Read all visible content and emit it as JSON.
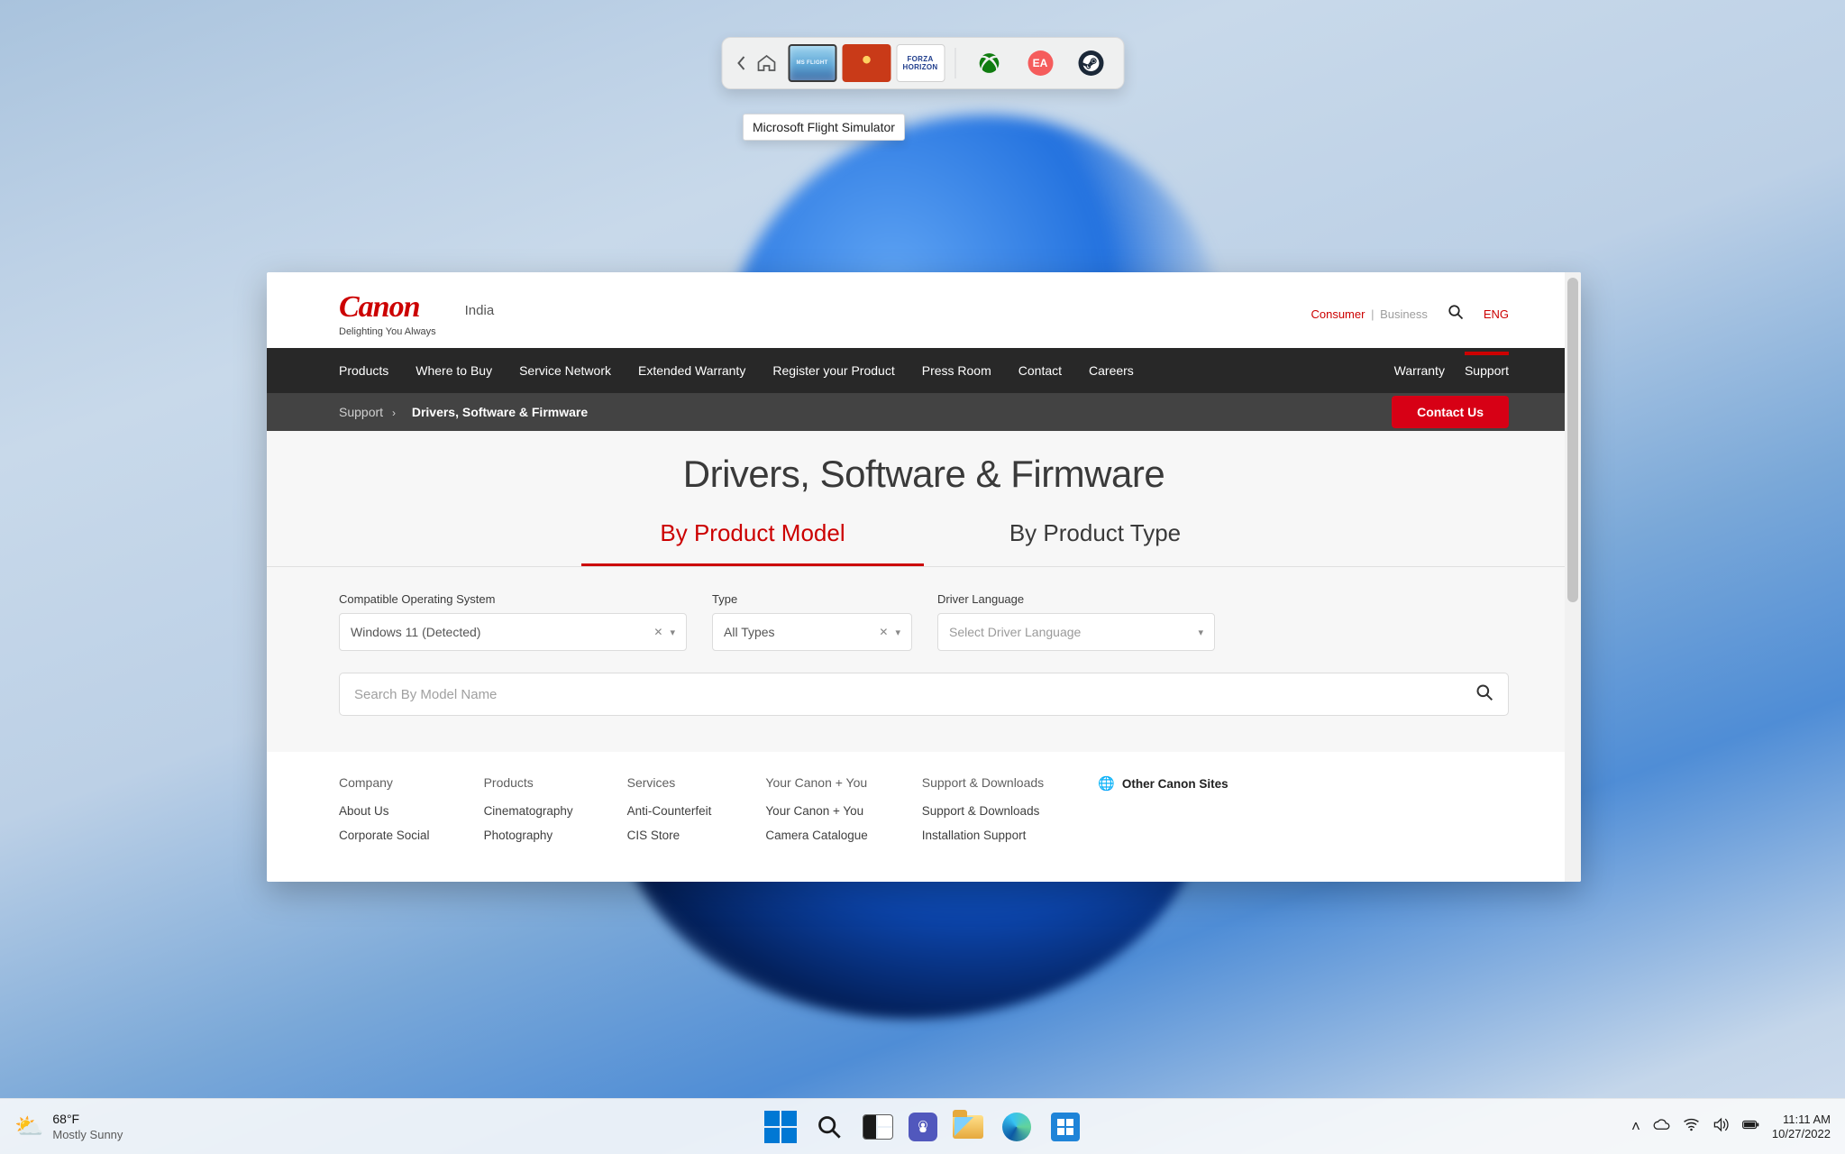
{
  "gamebar": {
    "tooltip": "Microsoft Flight Simulator",
    "forza_label": "FORZA\nHORIZON",
    "launchers": {
      "ea_label": "EA"
    }
  },
  "site": {
    "logo": "Canon",
    "tagline": "Delighting You Always",
    "region": "India",
    "consumer": "Consumer",
    "business": "Business",
    "lang": "ENG"
  },
  "nav": {
    "items": [
      "Products",
      "Where to Buy",
      "Service Network",
      "Extended Warranty",
      "Register your Product",
      "Press Room",
      "Contact",
      "Careers"
    ],
    "right": [
      "Warranty",
      "Support"
    ]
  },
  "breadcrumb": {
    "root": "Support",
    "current": "Drivers, Software & Firmware"
  },
  "contact_btn": "Contact Us",
  "page_title": "Drivers, Software & Firmware",
  "tabs": [
    "By Product Model",
    "By Product Type"
  ],
  "filters": {
    "os": {
      "label": "Compatible Operating System",
      "value": "Windows 11 (Detected)"
    },
    "type": {
      "label": "Type",
      "value": "All Types"
    },
    "lang": {
      "label": "Driver Language",
      "placeholder": "Select Driver Language"
    }
  },
  "model_search": {
    "placeholder": "Search By Model Name"
  },
  "footer": {
    "company": {
      "title": "Company",
      "links": [
        "About Us",
        "Corporate Social"
      ]
    },
    "products": {
      "title": "Products",
      "links": [
        "Cinematography",
        "Photography"
      ]
    },
    "services": {
      "title": "Services",
      "links": [
        "Anti-Counterfeit",
        "CIS Store"
      ]
    },
    "canon_you": {
      "title": "Your Canon + You",
      "links": [
        "Your Canon + You",
        "Camera Catalogue"
      ]
    },
    "support": {
      "title": "Support & Downloads",
      "links": [
        "Support & Downloads",
        "Installation Support"
      ]
    },
    "other": "Other Canon Sites"
  },
  "taskbar": {
    "weather": {
      "temp": "68°F",
      "desc": "Mostly Sunny"
    },
    "clock": {
      "time": "11:11 AM",
      "date": "10/27/2022"
    }
  }
}
